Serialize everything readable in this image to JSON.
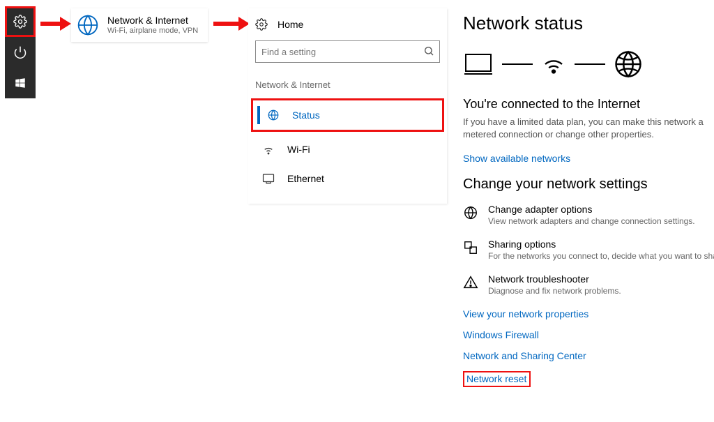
{
  "start_strip": {
    "items": [
      "settings",
      "power",
      "windows"
    ]
  },
  "category_tile": {
    "title": "Network & Internet",
    "subtitle": "Wi-Fi, airplane mode, VPN"
  },
  "nav": {
    "home_label": "Home",
    "search_placeholder": "Find a setting",
    "header": "Network & Internet",
    "items": [
      {
        "label": "Status",
        "active": true
      },
      {
        "label": "Wi-Fi",
        "active": false
      },
      {
        "label": "Ethernet",
        "active": false
      }
    ]
  },
  "main": {
    "title": "Network status",
    "connected_title": "You're connected to the Internet",
    "connected_sub": "If you have a limited data plan, you can make this network a metered connection or change other properties.",
    "show_networks": "Show available networks",
    "change_header": "Change your network settings",
    "rows": [
      {
        "title": "Change adapter options",
        "sub": "View network adapters and change connection settings."
      },
      {
        "title": "Sharing options",
        "sub": "For the networks you connect to, decide what you want to share"
      },
      {
        "title": "Network troubleshooter",
        "sub": "Diagnose and fix network problems."
      }
    ],
    "links": {
      "view_props": "View your network properties",
      "firewall": "Windows Firewall",
      "sharing_center": "Network and Sharing Center",
      "reset": "Network reset"
    }
  }
}
